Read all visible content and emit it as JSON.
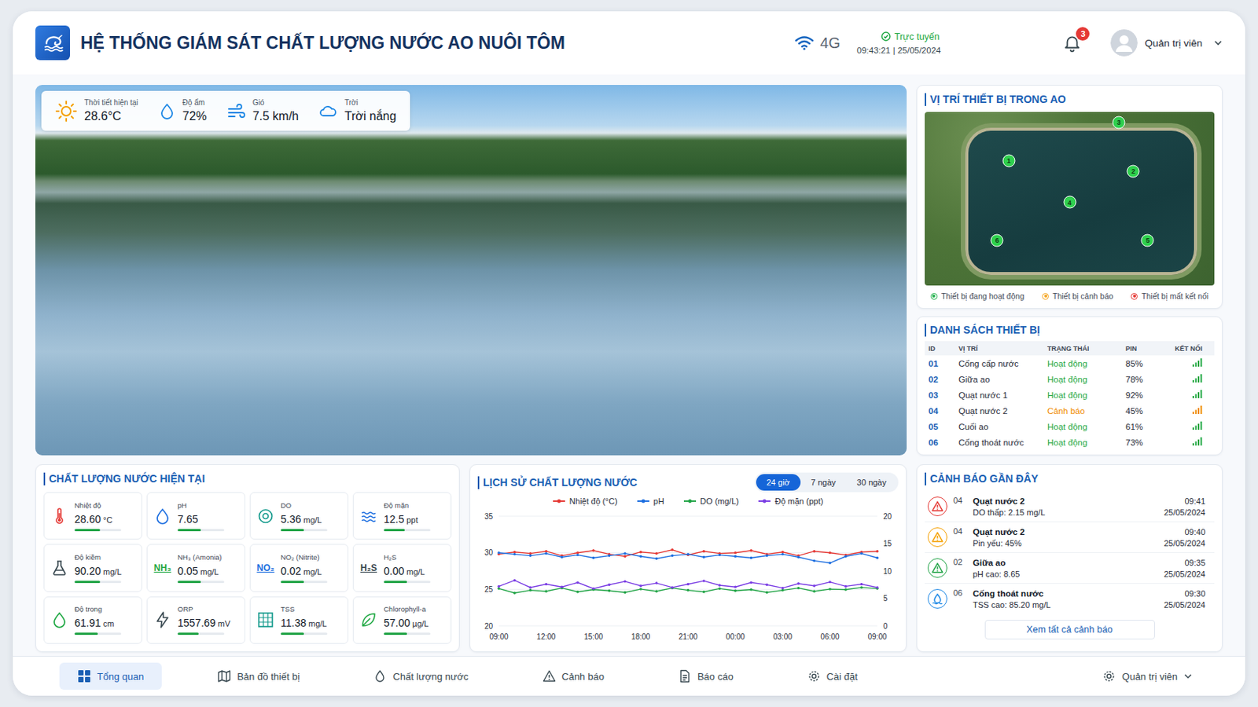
{
  "header": {
    "title": "HỆ THỐNG GIÁM SÁT CHẤT LƯỢNG NƯỚC AO NUÔI TÔM",
    "network": "4G",
    "status": "Trực tuyến",
    "datetime": "09:43:21 | 25/05/2024",
    "notifications": "3",
    "user": "Quản trị viên"
  },
  "weather": [
    {
      "label": "Thời tiết hiện tại",
      "value": "28.6°C"
    },
    {
      "label": "Độ ẩm",
      "value": "72%"
    },
    {
      "label": "Gió",
      "value": "7.5 km/h"
    },
    {
      "label": "Trời",
      "value": "Trời nắng"
    }
  ],
  "map": {
    "title": "VỊ TRÍ THIẾT BỊ TRONG AO",
    "pins": [
      {
        "label": "1",
        "color": "#2fd04e"
      },
      {
        "label": "2",
        "color": "#2fd04e"
      },
      {
        "label": "3",
        "color": "#2fd04e"
      },
      {
        "label": "4",
        "color": "#2fd04e"
      },
      {
        "label": "5",
        "color": "#2fd04e"
      },
      {
        "label": "6",
        "color": "#2fd04e"
      }
    ],
    "legend": [
      {
        "label": "Thiết bị đang hoạt động",
        "color": "#22b14c"
      },
      {
        "label": "Thiết bị cảnh báo",
        "color": "#f5a623"
      },
      {
        "label": "Thiết bị mất kết nối",
        "color": "#e53935"
      }
    ]
  },
  "devices": {
    "title": "DANH SÁCH THIẾT BỊ",
    "columns": [
      "ID",
      "VỊ TRÍ",
      "TRẠNG THÁI",
      "PIN",
      "KẾT NỐI"
    ],
    "rows": [
      {
        "id": "01",
        "location": "Cống cấp nước",
        "status": "Hoạt động",
        "battery": "85%",
        "color": "#1fa843"
      },
      {
        "id": "02",
        "location": "Giữa ao",
        "status": "Hoạt động",
        "battery": "78%",
        "color": "#1fa843"
      },
      {
        "id": "03",
        "location": "Quạt nước 1",
        "status": "Hoạt động",
        "battery": "92%",
        "color": "#1fa843"
      },
      {
        "id": "04",
        "location": "Quạt nước 2",
        "status": "Cảnh báo",
        "battery": "45%",
        "color": "#f08c00"
      },
      {
        "id": "05",
        "location": "Cuối ao",
        "status": "Hoạt động",
        "battery": "61%",
        "color": "#1fa843"
      },
      {
        "id": "06",
        "location": "Cống thoát nước",
        "status": "Hoạt động",
        "battery": "73%",
        "color": "#1fa843"
      }
    ]
  },
  "quality": {
    "title": "CHẤT LƯỢNG NƯỚC HIỆN TẠI",
    "metrics": [
      {
        "label": "Nhiệt độ",
        "value": "28.60",
        "unit": "°C",
        "level": 0.55
      },
      {
        "label": "pH",
        "value": "7.65",
        "level": 0.5
      },
      {
        "label": "DO",
        "value": "5.36",
        "unit": "mg/L",
        "level": 0.5
      },
      {
        "label": "Độ mặn",
        "value": "12.5",
        "unit": "ppt",
        "level": 0.45
      },
      {
        "label": "Độ kiềm",
        "value": "90.20",
        "unit": "mg/L",
        "level": 0.55
      },
      {
        "label": "NH₃ (Amonia)",
        "value": "0.05",
        "unit": "mg/L",
        "level": 0.5,
        "symbol": "NH₃"
      },
      {
        "label": "NO₂ (Nitrite)",
        "value": "0.02",
        "unit": "mg/L",
        "level": 0.5,
        "symbol": "NO₂"
      },
      {
        "label": "H₂S",
        "value": "0.00",
        "unit": "mg/L",
        "level": 0.5,
        "symbol": "H₂S"
      },
      {
        "label": "Độ trong",
        "value": "61.91",
        "unit": "cm",
        "level": 0.5
      },
      {
        "label": "ORP",
        "value": "1557.69",
        "unit": "mV",
        "level": 0.45
      },
      {
        "label": "TSS",
        "value": "11.38",
        "unit": "mg/L",
        "level": 0.5
      },
      {
        "label": "Chlorophyll-a",
        "value": "57.00",
        "unit": "µg/L",
        "level": 0.5
      }
    ]
  },
  "history": {
    "title": "LỊCH SỬ CHẤT LƯỢNG NƯỚC",
    "tabs": [
      {
        "label": "24 giờ",
        "selected": true
      },
      {
        "label": "7 ngày",
        "selected": false
      },
      {
        "label": "30 ngày",
        "selected": false
      }
    ],
    "left_axis": [
      "35",
      "30",
      "25",
      "20"
    ],
    "right_axis": [
      "20",
      "15",
      "10",
      "5",
      "0"
    ],
    "x_labels": [
      "09:00",
      "12:00",
      "15:00",
      "18:00",
      "21:00",
      "00:00",
      "03:00",
      "06:00",
      "09:00"
    ],
    "series": [
      {
        "name": "Nhiệt độ (°C)",
        "color": "#e53935",
        "axis": "left",
        "values": [
          29.8,
          30.1,
          29.9,
          30.2,
          29.6,
          30.0,
          30.3,
          29.8,
          29.5,
          30.1,
          29.9,
          30.4,
          29.7,
          30.2,
          29.9,
          30.0,
          30.3,
          29.8,
          30.1,
          29.6,
          30.2,
          30.0,
          29.7,
          30.1,
          30.2
        ]
      },
      {
        "name": "pH",
        "color": "#1e6fe0",
        "axis": "left",
        "values": [
          30.0,
          29.8,
          29.6,
          29.9,
          29.4,
          29.7,
          29.3,
          29.6,
          29.9,
          29.5,
          29.2,
          29.6,
          29.8,
          29.4,
          29.7,
          29.5,
          29.3,
          29.6,
          29.8,
          29.4,
          28.9,
          28.6,
          29.5,
          29.9,
          29.3
        ]
      },
      {
        "name": "DO (mg/L)",
        "color": "#22a447",
        "axis": "right",
        "values": [
          6.8,
          6.0,
          6.5,
          6.3,
          6.9,
          6.2,
          6.6,
          6.4,
          6.1,
          6.7,
          6.3,
          6.9,
          6.5,
          6.2,
          6.8,
          6.4,
          6.6,
          6.1,
          6.5,
          6.9,
          6.3,
          6.7,
          6.6,
          7.0,
          6.8
        ]
      },
      {
        "name": "Độ mặn (ppt)",
        "color": "#7b3fe4",
        "axis": "right",
        "values": [
          7.2,
          8.3,
          7.0,
          7.6,
          7.1,
          7.9,
          6.8,
          7.5,
          8.1,
          7.3,
          7.8,
          7.0,
          7.6,
          8.2,
          7.4,
          7.1,
          7.9,
          7.5,
          6.9,
          7.7,
          7.3,
          8.0,
          7.2,
          7.6,
          7.0
        ]
      }
    ]
  },
  "alerts": {
    "title": "CẢNH BÁO GẦN ĐÂY",
    "items": [
      {
        "id": "04",
        "title": "Quạt nước 2",
        "detail": "DO thấp: 2.15 mg/L",
        "time": "09:41",
        "date": "25/05/2024",
        "color": "#e53935",
        "kind": "warning"
      },
      {
        "id": "04",
        "title": "Quạt nước 2",
        "detail": "Pin yếu: 45%",
        "time": "09:40",
        "date": "25/05/2024",
        "color": "#f5a000",
        "kind": "warning"
      },
      {
        "id": "02",
        "title": "Giữa ao",
        "detail": "pH cao: 8.65",
        "time": "09:35",
        "date": "25/05/2024",
        "color": "#22a447",
        "kind": "warning"
      },
      {
        "id": "06",
        "title": "Cống thoát nước",
        "detail": "TSS cao: 85.20 mg/L",
        "time": "09:30",
        "date": "25/05/2024",
        "color": "#1e88e5",
        "kind": "water"
      }
    ],
    "button": "Xem tất cả cảnh báo"
  },
  "nav": {
    "items": [
      {
        "label": "Tổng quan",
        "selected": true
      },
      {
        "label": "Bản đồ thiết bị",
        "selected": false
      },
      {
        "label": "Chất lượng nước",
        "selected": false
      },
      {
        "label": "Cảnh báo",
        "selected": false
      },
      {
        "label": "Báo cáo",
        "selected": false
      },
      {
        "label": "Cài đặt",
        "selected": false
      }
    ],
    "user": "Quản trị viên"
  }
}
